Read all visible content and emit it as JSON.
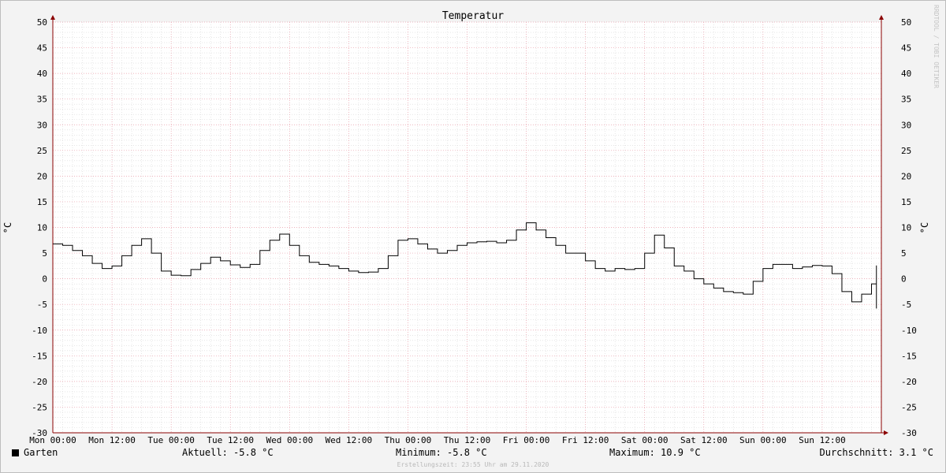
{
  "chart_data": {
    "type": "line",
    "title": "Temperatur",
    "ylabel": "°C",
    "ylim": [
      -30,
      50
    ],
    "y_ticks": [
      50,
      45,
      40,
      35,
      30,
      25,
      20,
      15,
      10,
      5,
      0,
      -5,
      -10,
      -15,
      -20,
      -25,
      -30
    ],
    "x_tick_labels": [
      "Mon 00:00",
      "Mon 12:00",
      "Tue 00:00",
      "Tue 12:00",
      "Wed 00:00",
      "Wed 12:00",
      "Thu 00:00",
      "Thu 12:00",
      "Fri 00:00",
      "Fri 12:00",
      "Sat 00:00",
      "Sat 12:00",
      "Sun 00:00",
      "Sun 12:00"
    ],
    "x_unit": "hours since Mon 00:00",
    "xlim": [
      0,
      168
    ],
    "grid": true,
    "colors": {
      "line": "#000000",
      "major_grid": "#e89aa6",
      "minor_grid": "#d7d7d7",
      "axis": "#8b0000"
    },
    "series": [
      {
        "name": "Garten",
        "x": [
          0,
          2,
          4,
          6,
          8,
          10,
          12,
          14,
          16,
          18,
          20,
          22,
          24,
          26,
          28,
          30,
          32,
          34,
          36,
          38,
          40,
          42,
          44,
          46,
          48,
          50,
          52,
          54,
          56,
          58,
          60,
          62,
          64,
          66,
          68,
          70,
          72,
          74,
          76,
          78,
          80,
          82,
          84,
          86,
          88,
          90,
          92,
          94,
          96,
          98,
          100,
          102,
          104,
          106,
          108,
          110,
          112,
          114,
          116,
          118,
          120,
          122,
          124,
          126,
          128,
          130,
          132,
          134,
          136,
          138,
          140,
          142,
          144,
          146,
          148,
          150,
          152,
          154,
          156,
          158,
          160,
          162,
          164,
          166,
          167
        ],
        "values": [
          6.8,
          6.5,
          5.5,
          4.5,
          3.0,
          2.0,
          2.5,
          4.5,
          6.5,
          7.8,
          5.0,
          1.5,
          0.7,
          0.6,
          1.8,
          3.0,
          4.2,
          3.5,
          2.7,
          2.2,
          2.8,
          5.5,
          7.5,
          8.7,
          6.5,
          4.5,
          3.2,
          2.8,
          2.5,
          2.0,
          1.5,
          1.2,
          1.3,
          2.0,
          4.5,
          7.5,
          7.8,
          6.8,
          5.8,
          5.0,
          5.5,
          6.5,
          7.0,
          7.2,
          7.3,
          7.0,
          7.5,
          9.5,
          10.9,
          9.5,
          8.0,
          6.5,
          5.0,
          5.0,
          3.5,
          2.0,
          1.5,
          2.0,
          1.8,
          2.0,
          5.0,
          8.5,
          6.0,
          2.5,
          1.5,
          0.0,
          -1.0,
          -1.8,
          -2.5,
          -2.7,
          -3.0,
          -0.5,
          2.0,
          2.8,
          2.8,
          2.0,
          2.3,
          2.6,
          2.5,
          1.0,
          -2.5,
          -4.5,
          -3.0,
          -1.0,
          0.0
        ],
        "values_tail": [
          1.5,
          2.5,
          2.6,
          0.0,
          -2.5,
          -4.0,
          -5.0,
          -5.8
        ]
      }
    ]
  },
  "legend": {
    "series_label": "Garten",
    "current": "Aktuell: -5.8 °C",
    "minimum": "Minimum: -5.8 °C",
    "maximum": "Maximum: 10.9 °C",
    "average": "Durchschnitt: 3.1 °C"
  },
  "footer": "Erstellungszeit: 23:55 Uhr am 29.11.2020",
  "watermark": "RRDTOOL / TOBI OETIKER"
}
